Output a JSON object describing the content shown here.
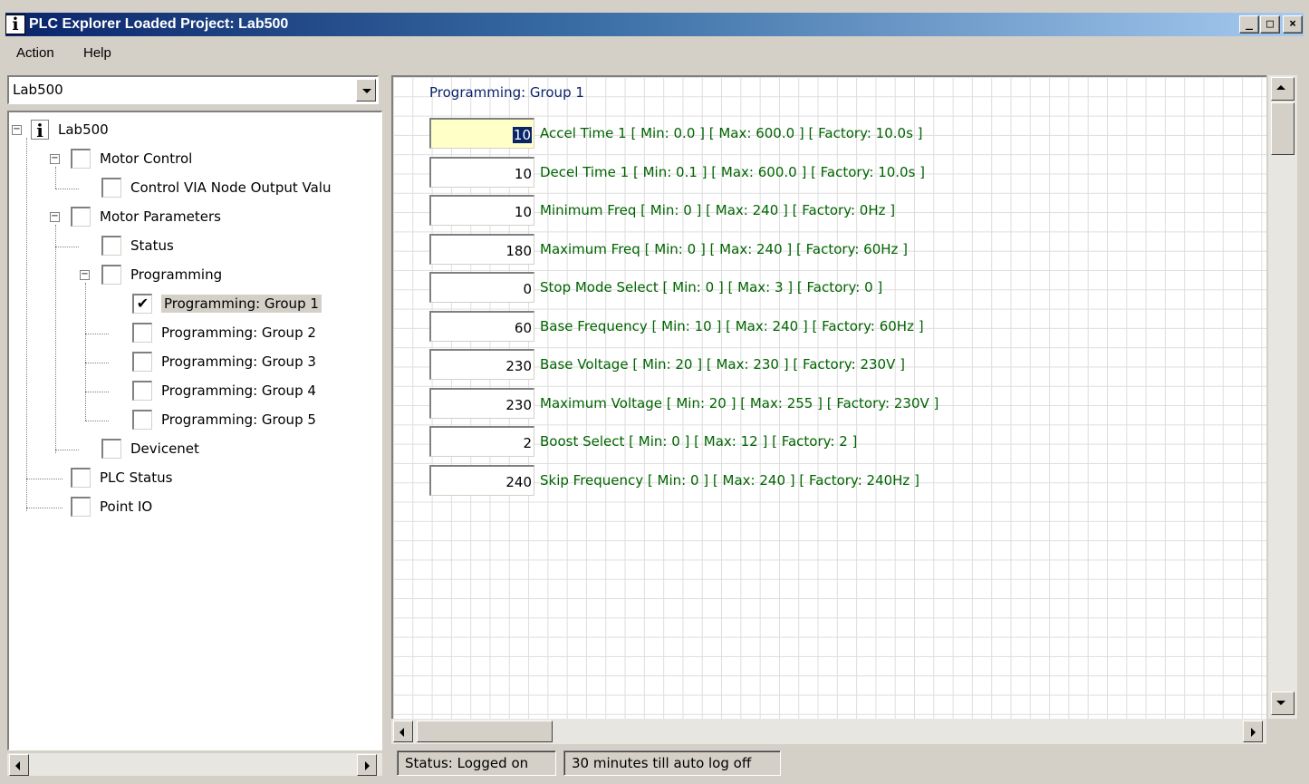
{
  "window": {
    "title": "PLC Explorer Loaded Project: Lab500",
    "icon_glyph": "i",
    "minimize": "_",
    "maximize": "□",
    "close": "×"
  },
  "menu": [
    "Action",
    "Help"
  ],
  "project_select": {
    "value": "Lab500"
  },
  "tree": {
    "root": "Lab500",
    "motor_control": "Motor Control",
    "control_via": "Control VIA Node Output Valu",
    "motor_parameters": "Motor Parameters",
    "status": "Status",
    "programming": "Programming",
    "groups": [
      "Programming: Group 1",
      "Programming: Group 2",
      "Programming: Group 3",
      "Programming: Group 4",
      "Programming: Group 5"
    ],
    "devicenet": "Devicenet",
    "plc_status": "PLC Status",
    "point_io": "Point IO",
    "checked_mark": "✔"
  },
  "main": {
    "group_title": "Programming: Group 1",
    "params": [
      {
        "value": "10",
        "label": "Accel Time 1  [ Min: 0.0 ] [ Max:  600.0 ] [ Factory: 10.0s ]"
      },
      {
        "value": "10",
        "label": "Decel Time 1  [ Min: 0.1 ] [ Max:  600.0 ] [ Factory: 10.0s ]"
      },
      {
        "value": "10",
        "label": "Minimum Freq  [ Min: 0 ] [ Max:  240 ] [ Factory: 0Hz ]"
      },
      {
        "value": "180",
        "label": "Maximum Freq  [ Min: 0 ] [ Max:  240 ] [ Factory: 60Hz ]"
      },
      {
        "value": "0",
        "label": "Stop Mode Select  [ Min: 0 ] [ Max:  3 ] [ Factory: 0 ]"
      },
      {
        "value": "60",
        "label": "Base Frequency  [ Min: 10 ] [ Max:  240 ] [ Factory: 60Hz ]"
      },
      {
        "value": "230",
        "label": "Base Voltage  [ Min: 20 ] [ Max:  230 ] [ Factory: 230V ]"
      },
      {
        "value": "230",
        "label": "Maximum Voltage  [ Min: 20 ] [ Max:  255 ] [ Factory: 230V ]"
      },
      {
        "value": "2",
        "label": "Boost Select  [ Min: 0 ] [ Max:  12 ] [ Factory: 2 ]"
      },
      {
        "value": "240",
        "label": "Skip Frequency  [ Min: 0 ] [ Max:  240 ] [ Factory: 240Hz ]"
      }
    ]
  },
  "status": {
    "login": "Status: Logged on",
    "timer": "30 minutes till auto log off"
  },
  "colors": {
    "title_gradient_start": "#0a246a",
    "param_label": "#006400",
    "active_input_bg": "#ffffc8"
  }
}
